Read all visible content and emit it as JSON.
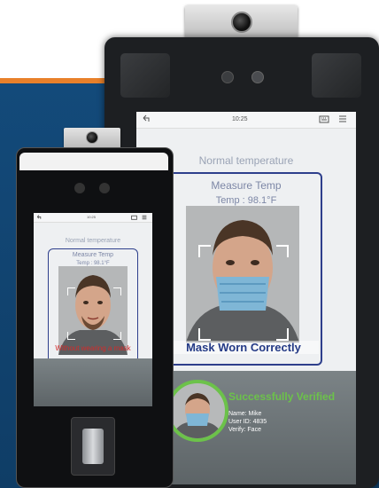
{
  "large_device": {
    "status_bar": {
      "time": "10:25"
    },
    "top_label": "Normal temperature",
    "measure_label": "Measure Temp",
    "temp_reading": "Temp : 98.1°F",
    "result_banner": "Mask Worn Correctly",
    "verification": {
      "title": "Successfully Verified",
      "name_line": "Name: Mike",
      "user_id_line": "User ID: 4835",
      "verify_line": "Verify: Face"
    }
  },
  "small_device": {
    "status_bar": {
      "time": "10:25"
    },
    "top_label": "Normal temperature",
    "measure_label": "Measure Temp",
    "temp_reading": "Temp : 98.1°F",
    "result_banner": "Without wearing a mask"
  },
  "colors": {
    "banner_blue": "#134a7a",
    "accent_orange": "#e8802a",
    "success_green": "#6cc24a",
    "frame_blue": "#2e3f8c",
    "warning_red": "#d42a2a"
  },
  "icons": [
    "back-arrow-icon",
    "menu-icon",
    "keyboard-icon",
    "camera-lens-icon",
    "fingerprint-scanner-icon"
  ]
}
